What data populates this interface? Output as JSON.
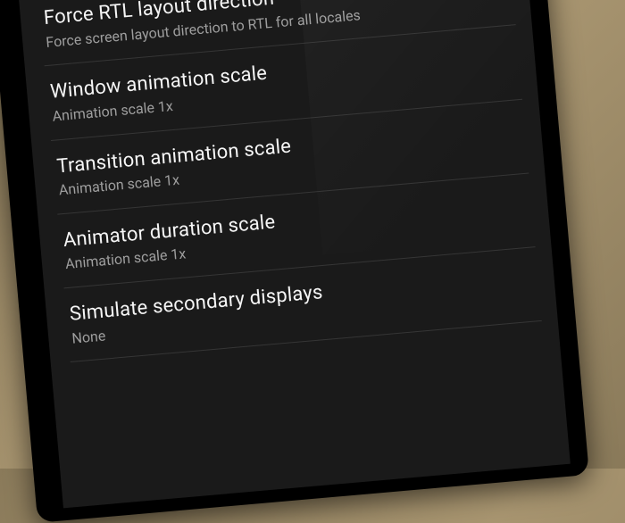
{
  "settings": {
    "items": [
      {
        "title": "Force RTL layout direction",
        "subtitle": "Force screen layout direction to RTL for all locales",
        "has_toggle": true,
        "toggle_state": "off"
      },
      {
        "title": "Window animation scale",
        "subtitle": "Animation scale 1x"
      },
      {
        "title": "Transition animation scale",
        "subtitle": "Animation scale 1x"
      },
      {
        "title": "Animator duration scale",
        "subtitle": "Animation scale 1x"
      },
      {
        "title": "Simulate secondary displays",
        "subtitle": "None"
      }
    ]
  }
}
